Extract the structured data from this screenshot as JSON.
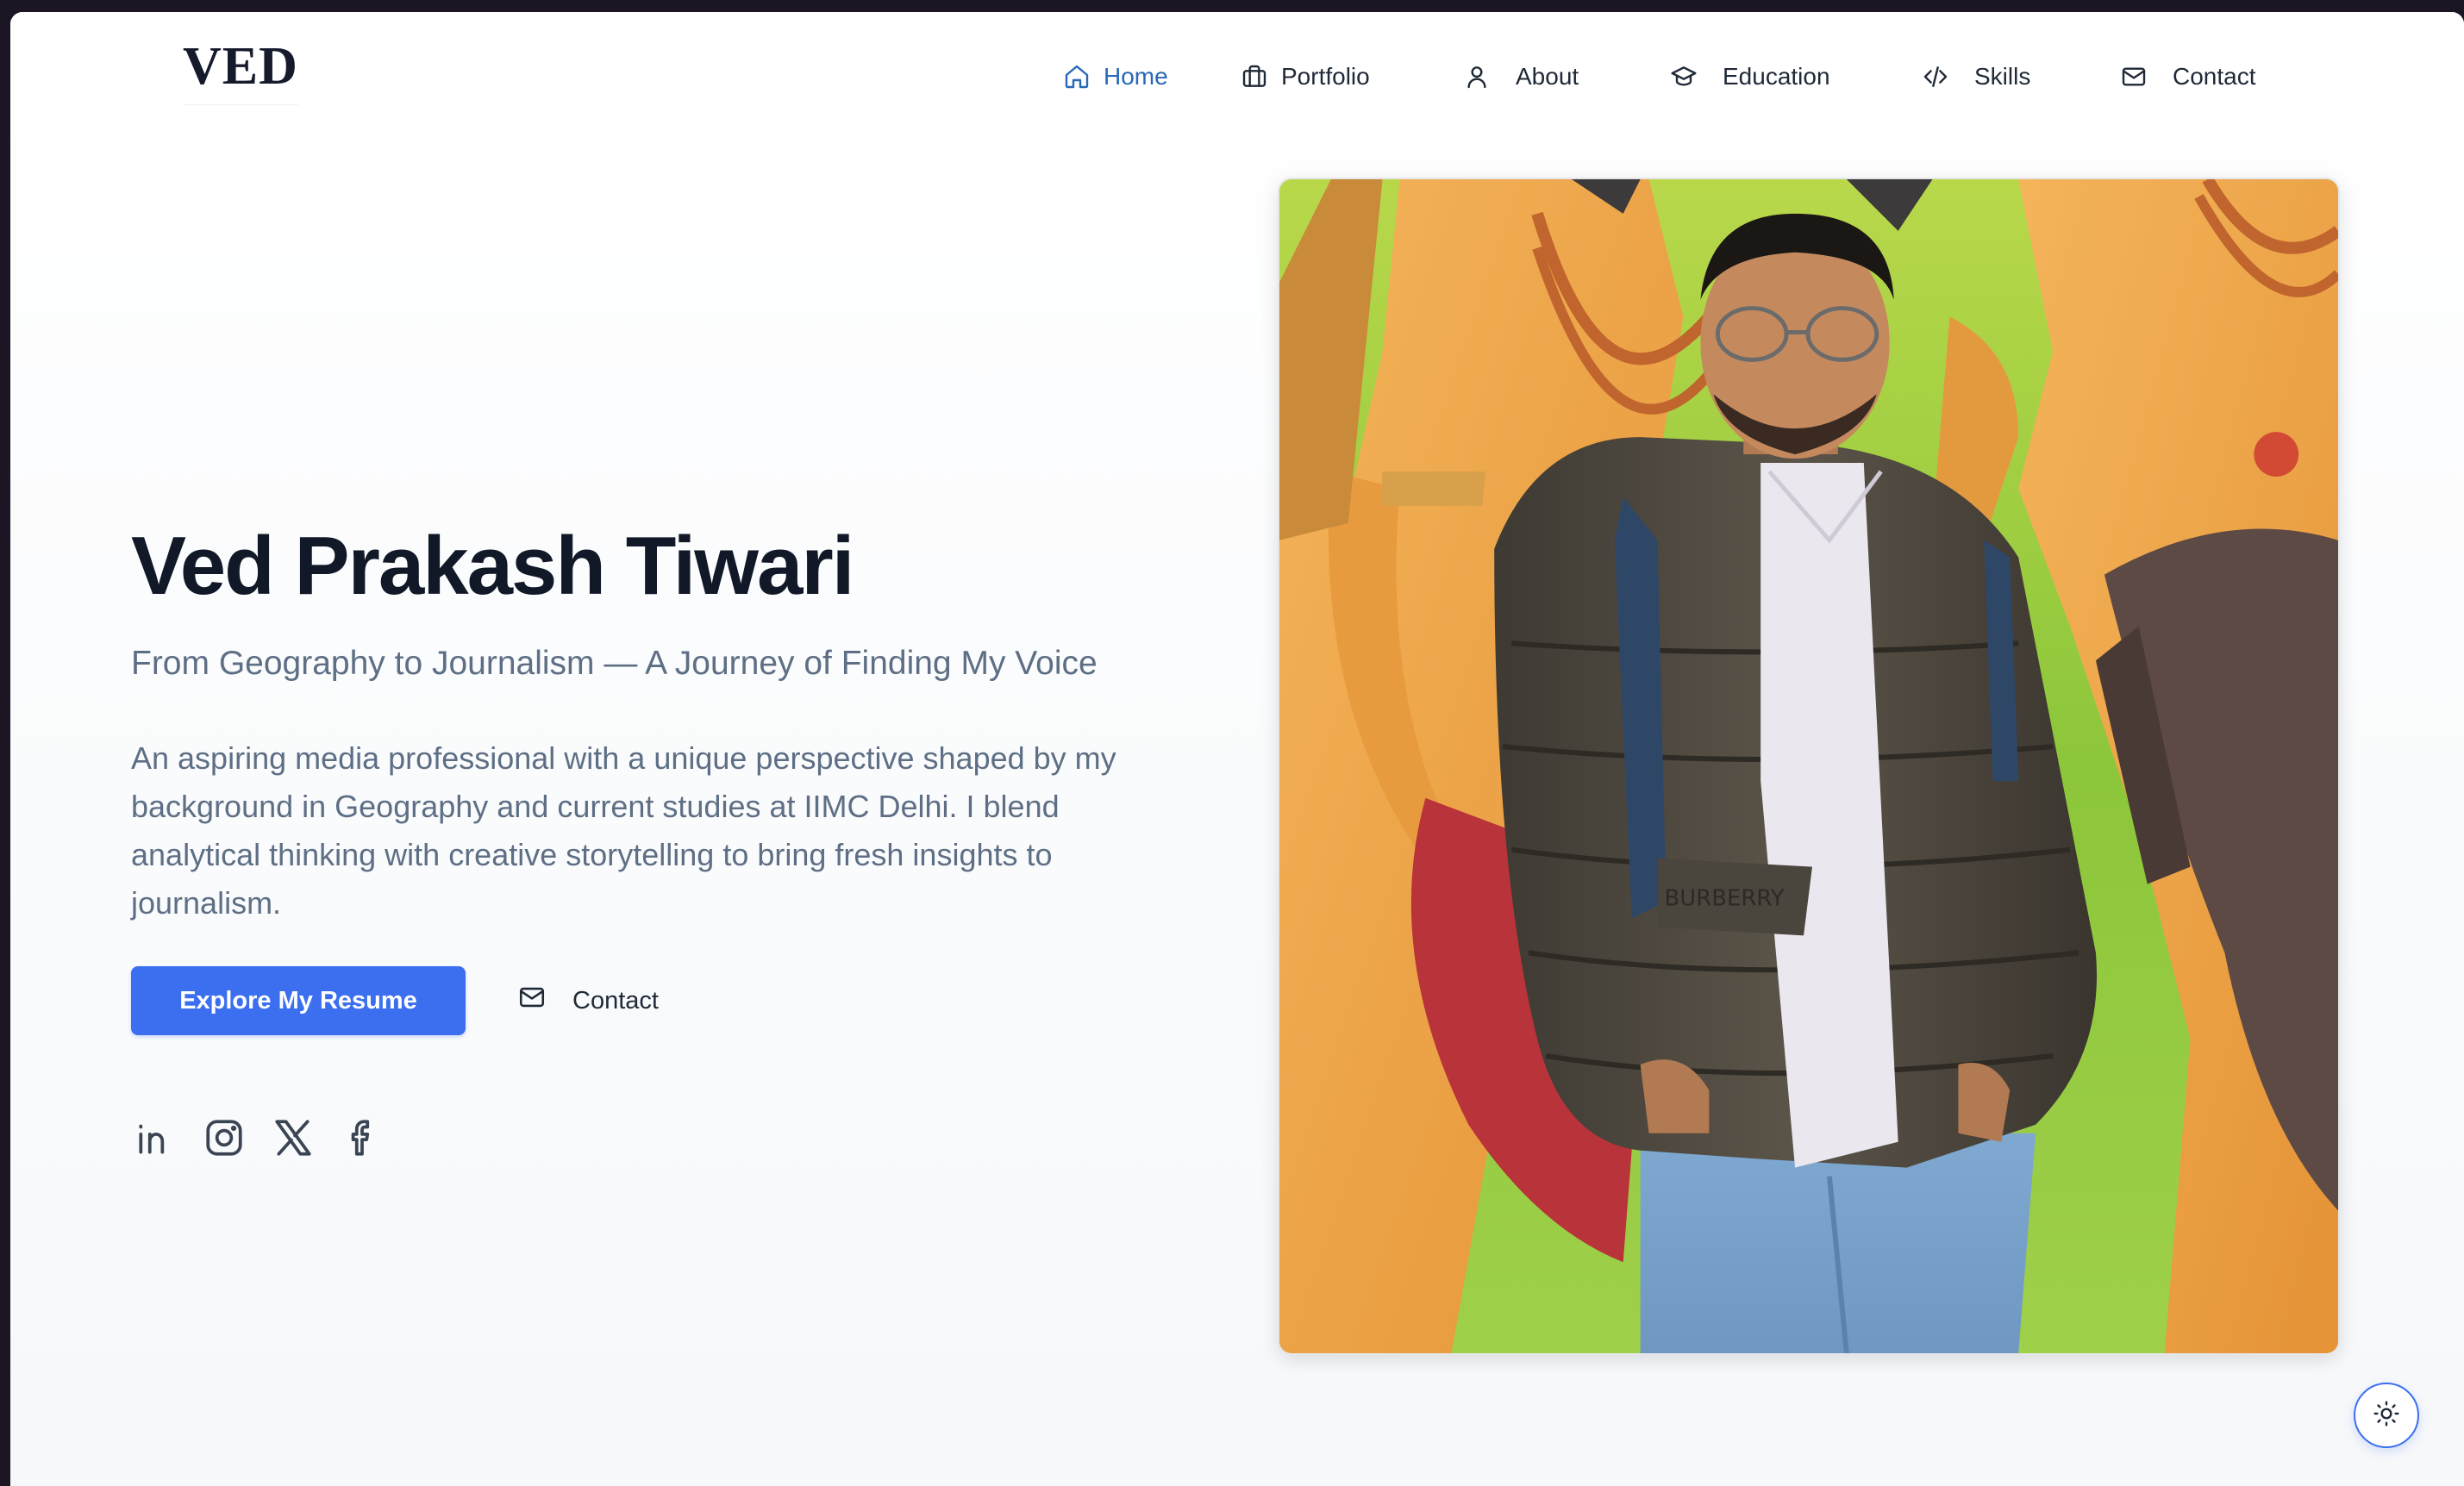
{
  "logo": "VED",
  "nav": {
    "items": [
      {
        "label": "Home",
        "icon": "home-icon",
        "active": true
      },
      {
        "label": "Portfolio",
        "icon": "briefcase-icon"
      },
      {
        "label": "About",
        "icon": "user-icon"
      },
      {
        "label": "Education",
        "icon": "graduation-cap-icon"
      },
      {
        "label": "Skills",
        "icon": "code-icon"
      },
      {
        "label": "Contact",
        "icon": "mail-icon"
      }
    ]
  },
  "hero": {
    "title": "Ved Prakash Tiwari",
    "subtitle": "From Geography to Journalism — A Journey of Finding My Voice",
    "description": "An aspiring media professional with a unique perspective shaped by my background in Geography and current studies at IIMC Delhi. I blend analytical thinking with creative storytelling to bring fresh insights to journalism.",
    "primary_button": "Explore My Resume",
    "contact_button": "Contact",
    "jacket_text": "BURBERRY"
  },
  "socials": [
    "linkedin-icon",
    "instagram-icon",
    "x-icon",
    "facebook-icon"
  ],
  "theme_toggle": "sun-icon",
  "colors": {
    "accent": "#3b6ff0",
    "nav_active": "#2868b8",
    "title": "#111827",
    "muted": "#5e6f85"
  }
}
